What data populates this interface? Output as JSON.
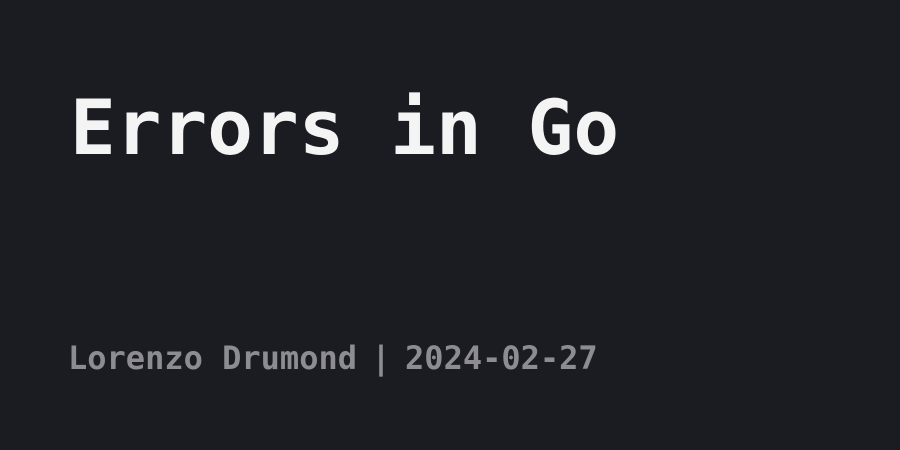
{
  "post": {
    "title": "Errors in Go",
    "author": "Lorenzo Drumond",
    "separator": "|",
    "date": "2024-02-27"
  },
  "colors": {
    "background": "#1b1c22",
    "title": "#f4f4f5",
    "meta": "#8c8c92"
  }
}
